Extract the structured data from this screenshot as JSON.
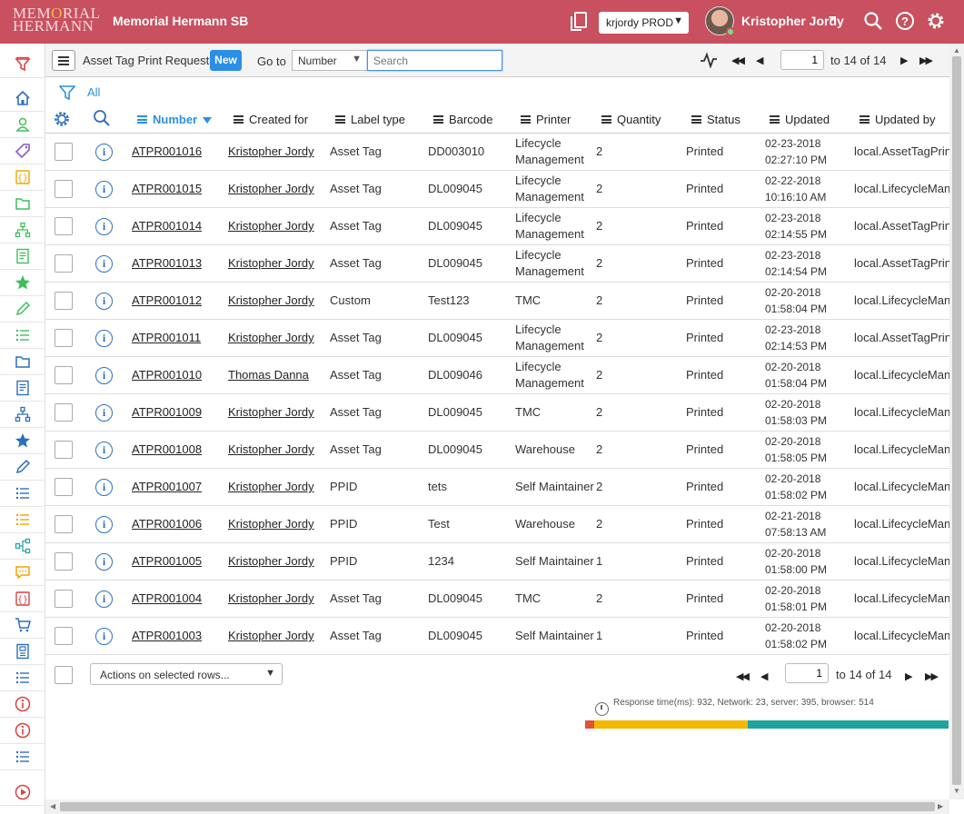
{
  "header": {
    "logo_line1": "MEMORIAL",
    "logo_line2": "HERMANN",
    "instance_name": "Memorial Hermann SB",
    "environment": "krjordy PROD",
    "user_name": "Kristopher Jordy",
    "brand_color": "#c8505f"
  },
  "toolbar": {
    "list_title": "Asset Tag Print Requests",
    "new_label": "New",
    "goto_label": "Go to",
    "goto_field": "Number",
    "search_placeholder": "Search",
    "page_value": "1",
    "range_text": "to 14 of 14"
  },
  "breadcrumb": {
    "all_label": "All"
  },
  "columns": [
    "Number",
    "Created for",
    "Label type",
    "Barcode",
    "Printer",
    "Quantity",
    "Status",
    "Updated",
    "Updated by"
  ],
  "rows": [
    {
      "number": "ATPR001016",
      "created_for": "Kristopher Jordy",
      "label_type": "Asset Tag",
      "barcode": "DD003010",
      "printer_l1": "Lifecycle",
      "printer_l2": "Management",
      "quantity": "2",
      "status": "Printed",
      "updated_date": "02-23-2018",
      "updated_time": "02:27:10 PM",
      "updated_by": "local.AssetTagPrint"
    },
    {
      "number": "ATPR001015",
      "created_for": "Kristopher Jordy",
      "label_type": "Asset Tag",
      "barcode": "DL009045",
      "printer_l1": "Lifecycle",
      "printer_l2": "Management",
      "quantity": "2",
      "status": "Printed",
      "updated_date": "02-22-2018",
      "updated_time": "10:16:10 AM",
      "updated_by": "local.LifecycleMana"
    },
    {
      "number": "ATPR001014",
      "created_for": "Kristopher Jordy",
      "label_type": "Asset Tag",
      "barcode": "DL009045",
      "printer_l1": "Lifecycle",
      "printer_l2": "Management",
      "quantity": "2",
      "status": "Printed",
      "updated_date": "02-23-2018",
      "updated_time": "02:14:55 PM",
      "updated_by": "local.AssetTagPrint"
    },
    {
      "number": "ATPR001013",
      "created_for": "Kristopher Jordy",
      "label_type": "Asset Tag",
      "barcode": "DL009045",
      "printer_l1": "Lifecycle",
      "printer_l2": "Management",
      "quantity": "2",
      "status": "Printed",
      "updated_date": "02-23-2018",
      "updated_time": "02:14:54 PM",
      "updated_by": "local.AssetTagPrint"
    },
    {
      "number": "ATPR001012",
      "created_for": "Kristopher Jordy",
      "label_type": "Custom",
      "barcode": "Test123",
      "printer_l1": "TMC",
      "printer_l2": "",
      "quantity": "2",
      "status": "Printed",
      "updated_date": "02-20-2018",
      "updated_time": "01:58:04 PM",
      "updated_by": "local.LifecycleMana"
    },
    {
      "number": "ATPR001011",
      "created_for": "Kristopher Jordy",
      "label_type": "Asset Tag",
      "barcode": "DL009045",
      "printer_l1": "Lifecycle",
      "printer_l2": "Management",
      "quantity": "2",
      "status": "Printed",
      "updated_date": "02-23-2018",
      "updated_time": "02:14:53 PM",
      "updated_by": "local.AssetTagPrint"
    },
    {
      "number": "ATPR001010",
      "created_for": "Thomas Danna",
      "label_type": "Asset Tag",
      "barcode": "DL009046",
      "printer_l1": "Lifecycle",
      "printer_l2": "Management",
      "quantity": "2",
      "status": "Printed",
      "updated_date": "02-20-2018",
      "updated_time": "01:58:04 PM",
      "updated_by": "local.LifecycleMana"
    },
    {
      "number": "ATPR001009",
      "created_for": "Kristopher Jordy",
      "label_type": "Asset Tag",
      "barcode": "DL009045",
      "printer_l1": "TMC",
      "printer_l2": "",
      "quantity": "2",
      "status": "Printed",
      "updated_date": "02-20-2018",
      "updated_time": "01:58:03 PM",
      "updated_by": "local.LifecycleMana"
    },
    {
      "number": "ATPR001008",
      "created_for": "Kristopher Jordy",
      "label_type": "Asset Tag",
      "barcode": "DL009045",
      "printer_l1": "Warehouse",
      "printer_l2": "",
      "quantity": "2",
      "status": "Printed",
      "updated_date": "02-20-2018",
      "updated_time": "01:58:05 PM",
      "updated_by": "local.LifecycleMana"
    },
    {
      "number": "ATPR001007",
      "created_for": "Kristopher Jordy",
      "label_type": "PPID",
      "barcode": "tets",
      "printer_l1": "Self Maintainer",
      "printer_l2": "",
      "quantity": "2",
      "status": "Printed",
      "updated_date": "02-20-2018",
      "updated_time": "01:58:02 PM",
      "updated_by": "local.LifecycleMana"
    },
    {
      "number": "ATPR001006",
      "created_for": "Kristopher Jordy",
      "label_type": "PPID",
      "barcode": "Test",
      "printer_l1": "Warehouse",
      "printer_l2": "",
      "quantity": "2",
      "status": "Printed",
      "updated_date": "02-21-2018",
      "updated_time": "07:58:13 AM",
      "updated_by": "local.LifecycleMana"
    },
    {
      "number": "ATPR001005",
      "created_for": "Kristopher Jordy",
      "label_type": "PPID",
      "barcode": "1234",
      "printer_l1": "Self Maintainer",
      "printer_l2": "",
      "quantity": "1",
      "status": "Printed",
      "updated_date": "02-20-2018",
      "updated_time": "01:58:00 PM",
      "updated_by": "local.LifecycleMana"
    },
    {
      "number": "ATPR001004",
      "created_for": "Kristopher Jordy",
      "label_type": "Asset Tag",
      "barcode": "DL009045",
      "printer_l1": "TMC",
      "printer_l2": "",
      "quantity": "2",
      "status": "Printed",
      "updated_date": "02-20-2018",
      "updated_time": "01:58:01 PM",
      "updated_by": "local.LifecycleMana"
    },
    {
      "number": "ATPR001003",
      "created_for": "Kristopher Jordy",
      "label_type": "Asset Tag",
      "barcode": "DL009045",
      "printer_l1": "Self Maintainer",
      "printer_l2": "",
      "quantity": "1",
      "status": "Printed",
      "updated_date": "02-20-2018",
      "updated_time": "01:58:02 PM",
      "updated_by": "local.LifecycleMana"
    }
  ],
  "footer": {
    "actions_label": "Actions on selected rows...",
    "page_value": "1",
    "range_text": "to 14 of 14",
    "response_time": "Response time(ms): 932, Network: 23, server: 395, browser: 514"
  },
  "perf_bar": {
    "network_ms": 23,
    "server_ms": 395,
    "browser_ms": 514,
    "colors": {
      "network": "#e0533a",
      "server": "#f5b800",
      "browser": "#1fa39a"
    }
  },
  "nav_icons": [
    "filter-icon",
    "home-icon",
    "user-icon",
    "tag-icon",
    "script-icon",
    "folder-icon",
    "hierarchy-icon",
    "form-icon",
    "star-icon",
    "pencil-icon",
    "list-icon",
    "folder-icon",
    "form-icon",
    "hierarchy-icon",
    "star-icon",
    "pencil-icon",
    "list-icon",
    "list-icon",
    "workflow-icon",
    "chat-icon",
    "script-icon",
    "cart-icon",
    "report-icon",
    "list-icon",
    "info-icon",
    "info-icon",
    "list-icon",
    "play-icon"
  ],
  "accent_color": "#2b8fe5"
}
